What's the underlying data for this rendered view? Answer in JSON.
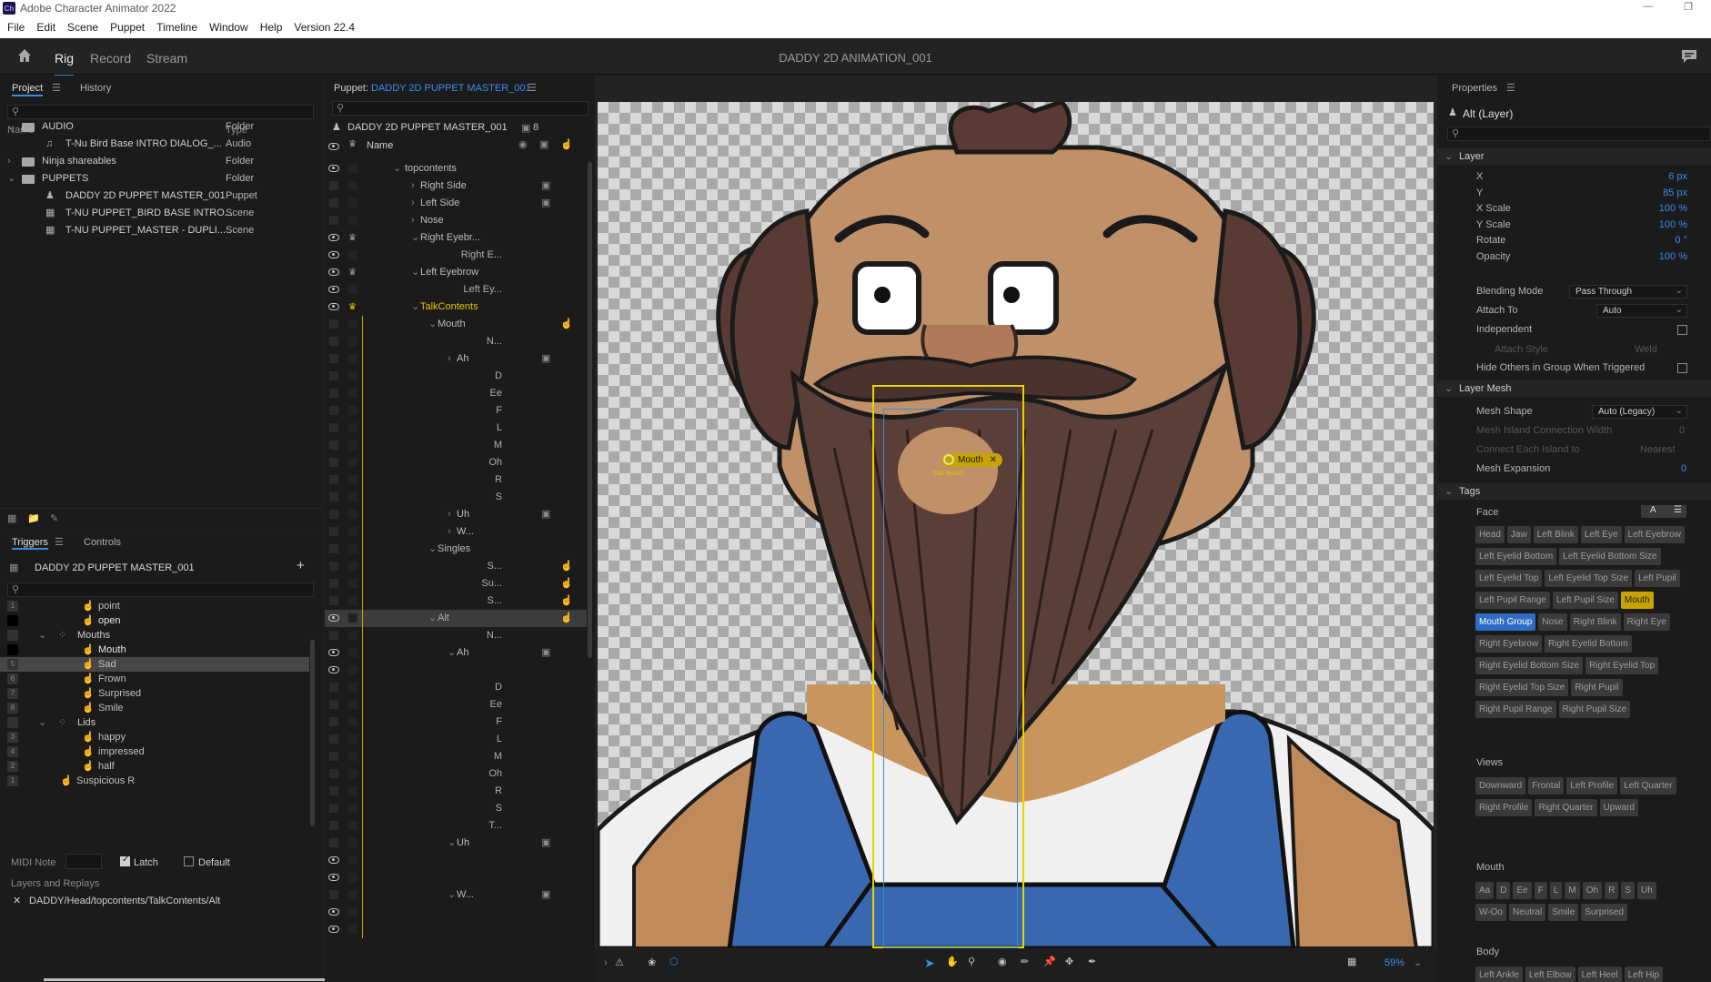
{
  "app": {
    "title": "Adobe Character Animator 2022",
    "logo": "Ch"
  },
  "menu": [
    "File",
    "Edit",
    "Scene",
    "Puppet",
    "Timeline",
    "Window",
    "Help",
    "Version 22.4"
  ],
  "nav": {
    "tabs": [
      "Rig",
      "Record",
      "Stream"
    ],
    "active": "Rig",
    "document_title": "DADDY 2D ANIMATION_001"
  },
  "project": {
    "tabs": [
      "Project",
      "History"
    ],
    "columns": [
      "Name",
      "Type"
    ],
    "rows": [
      {
        "name": "AUDIO",
        "type": "Folder"
      },
      {
        "name": "T-Nu Bird Base INTRO  DIALOG_...",
        "type": "Audio"
      },
      {
        "name": "Ninja shareables",
        "type": "Folder"
      },
      {
        "name": "PUPPETS",
        "type": "Folder"
      },
      {
        "name": "DADDY 2D PUPPET MASTER_001",
        "type": "Puppet"
      },
      {
        "name": "T-NU PUPPET_BIRD BASE INTRO...",
        "type": "Scene"
      },
      {
        "name": "T-NU PUPPET_MASTER - DUPLI...",
        "type": "Scene"
      }
    ]
  },
  "triggers": {
    "tabs": [
      "Triggers",
      "Controls"
    ],
    "puppet": "DADDY 2D PUPPET MASTER_001",
    "rows": [
      {
        "key": "1",
        "name": "point"
      },
      {
        "key": "",
        "name": "open"
      },
      {
        "key": "",
        "name": "Mouths"
      },
      {
        "key": "",
        "name": "Mouth"
      },
      {
        "key": "5",
        "name": "Sad"
      },
      {
        "key": "6",
        "name": "Frown"
      },
      {
        "key": "7",
        "name": "Surprised"
      },
      {
        "key": "8",
        "name": "Smile"
      },
      {
        "key": "",
        "name": "Lids"
      },
      {
        "key": "3",
        "name": "happy"
      },
      {
        "key": "4",
        "name": "impressed"
      },
      {
        "key": "2",
        "name": "half"
      },
      {
        "key": "1",
        "name": "Suspicious R"
      }
    ],
    "midi_label": "MIDI Note",
    "latch_label": "Latch",
    "default_label": "Default",
    "layers_label": "Layers and Replays",
    "layer_path": "DADDY/Head/topcontents/TalkContents/Alt"
  },
  "puppet": {
    "label": "Puppet:",
    "name": "DADDY 2D PUPPET MASTER_001",
    "header_name": "DADDY 2D PUPPET MASTER_001",
    "count": "8",
    "column": "Name",
    "layers": [
      {
        "name": "topcontents",
        "eye": true
      },
      {
        "name": "Right Side",
        "eye": false
      },
      {
        "name": "Left Side",
        "eye": false
      },
      {
        "name": "Nose",
        "eye": false
      },
      {
        "name": "Right Eyebr...",
        "eye": true
      },
      {
        "name": "Right E...",
        "eye": true
      },
      {
        "name": "Left Eyebrow",
        "eye": true
      },
      {
        "name": "Left Ey...",
        "eye": true
      },
      {
        "name": "TalkContents",
        "eye": true
      },
      {
        "name": "Mouth",
        "eye": false
      },
      {
        "name": "N...",
        "eye": false
      },
      {
        "name": "Ah",
        "eye": false
      },
      {
        "name": "D",
        "eye": false
      },
      {
        "name": "Ee",
        "eye": false
      },
      {
        "name": "F",
        "eye": false
      },
      {
        "name": "L",
        "eye": false
      },
      {
        "name": "M",
        "eye": false
      },
      {
        "name": "Oh",
        "eye": false
      },
      {
        "name": "R",
        "eye": false
      },
      {
        "name": "S",
        "eye": false
      },
      {
        "name": "Uh",
        "eye": false
      },
      {
        "name": "W...",
        "eye": false
      },
      {
        "name": "Singles",
        "eye": false
      },
      {
        "name": "S...",
        "eye": false
      },
      {
        "name": "Su...",
        "eye": false
      },
      {
        "name": "S...",
        "eye": false
      },
      {
        "name": "Alt",
        "eye": true
      },
      {
        "name": "N...",
        "eye": false
      },
      {
        "name": "Ah",
        "eye": true
      },
      {
        "name": "",
        "eye": true
      },
      {
        "name": "D",
        "eye": false
      },
      {
        "name": "Ee",
        "eye": false
      },
      {
        "name": "F",
        "eye": false
      },
      {
        "name": "L",
        "eye": false
      },
      {
        "name": "M",
        "eye": false
      },
      {
        "name": "Oh",
        "eye": false
      },
      {
        "name": "R",
        "eye": false
      },
      {
        "name": "S",
        "eye": false
      },
      {
        "name": "T...",
        "eye": false
      },
      {
        "name": "Uh",
        "eye": false
      },
      {
        "name": "",
        "eye": true
      },
      {
        "name": "",
        "eye": true
      },
      {
        "name": "W...",
        "eye": false
      },
      {
        "name": "",
        "eye": true
      },
      {
        "name": "",
        "eye": true
      }
    ]
  },
  "canvas": {
    "handle_label": "Mouth",
    "handle_sub": "Sad Mouth",
    "zoom": "59%"
  },
  "properties": {
    "title": "Properties",
    "layer_name": "Alt (Layer)",
    "layer_section": "Layer",
    "rows": [
      {
        "label": "X",
        "value": "6 px"
      },
      {
        "label": "Y",
        "value": "85 px"
      },
      {
        "label": "X Scale",
        "value": "100 %"
      },
      {
        "label": "Y Scale",
        "value": "100 %"
      },
      {
        "label": "Rotate",
        "value": "0 °"
      },
      {
        "label": "Opacity",
        "value": "100 %"
      }
    ],
    "blending_label": "Blending Mode",
    "blending_value": "Pass Through",
    "attach_label": "Attach To",
    "attach_value": "Auto",
    "independent_label": "Independent",
    "attach_style_label": "Attach Style",
    "attach_style_value": "Weld",
    "hide_others_label": "Hide Others in Group When Triggered",
    "mesh_section": "Layer Mesh",
    "mesh_shape_label": "Mesh Shape",
    "mesh_shape_value": "Auto (Legacy)",
    "mesh_island_label": "Mesh Island Connection Width",
    "mesh_island_value": "0",
    "connect_label": "Connect Each Island to",
    "connect_value": "Nearest",
    "expansion_label": "Mesh Expansion",
    "expansion_value": "0",
    "tags_section": "Tags",
    "face_label": "Face",
    "face_tags": [
      "Head",
      "Jaw",
      "Left Blink",
      "Left Eye",
      "Left Eyebrow",
      "Left Eyelid Bottom",
      "Left Eyelid Bottom Size",
      "Left Eyelid Top",
      "Left Eyelid Top Size",
      "Left Pupil",
      "Left Pupil Range",
      "Left Pupil Size",
      "Mouth",
      "Mouth Group",
      "Nose",
      "Right Blink",
      "Right Eye",
      "Right Eyebrow",
      "Right Eyelid Bottom",
      "Right Eyelid Bottom Size",
      "Right Eyelid Top",
      "Right Eyelid Top Size",
      "Right Pupil",
      "Right Pupil Range",
      "Right Pupil Size"
    ],
    "views_label": "Views",
    "view_tags": [
      "Downward",
      "Frontal",
      "Left Profile",
      "Left Quarter",
      "Right Profile",
      "Right Quarter",
      "Upward"
    ],
    "mouth_label": "Mouth",
    "mouth_tags": [
      "Aa",
      "D",
      "Ee",
      "F",
      "L",
      "M",
      "Oh",
      "R",
      "S",
      "Uh",
      "W-Oo",
      "Neutral",
      "Smile",
      "Surprised"
    ],
    "body_label": "Body",
    "body_tags": [
      "Left Ankle",
      "Left Elbow",
      "Left Heel",
      "Left Hip"
    ]
  },
  "colors": {
    "accent": "#3b8be0",
    "selection_yellow": "#e6d400",
    "mouth_tag": "#c8a400",
    "mouth_group_tag": "#2f6cc4"
  }
}
